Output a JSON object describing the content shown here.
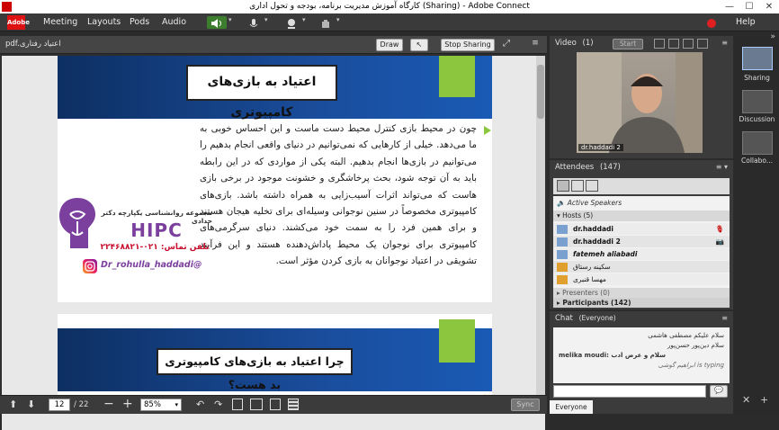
{
  "window": {
    "title": "کارگاه آموزش مدیریت برنامه، بودجه و تحول اداری (Sharing) - Adobe Connect",
    "help": "Help"
  },
  "menu": {
    "logo": "Adobe",
    "items": [
      "Meeting",
      "Layouts",
      "Pods",
      "Audio"
    ]
  },
  "share": {
    "filename": "pdf.اعتیاد رفتاری",
    "draw_label": "Draw",
    "stop_label": "Stop Sharing",
    "page_current": "12",
    "page_total": "/ 22",
    "zoom": "85%",
    "sync_label": "Sync"
  },
  "slide1": {
    "title": "اعتیاد به بازی‌های کامپیوتری",
    "body": "چون در محیط بازی کنترل محیط دست ماست و این احساس خوبی به ما می‌دهد. خیلی از کارهایی که نمی‌توانیم در دنیای واقعی انجام بدهیم را می‌توانیم در بازی‌ها انجام بدهیم. البته یکی از مواردی که در این رابطه باید به آن توجه شود، بحث پرخاشگری و خشونت موجود در برخی بازی هاست که می‌تواند اثرات آسیب‌زایی به همراه داشته باشد. بازی‌های کامپیوتری مخصوصاً در سنین نوجوانی وسیله‌ای برای تخلیه هیجان هستند و برای همین فرد را به سمت خود می‌کشند. دنیای سرگرمی‌های کامپیوتری برای نوجوان یک محیط پاداش‌دهنده هستند و این فرآیند تشویقی در اعتیاد نوجوانان به بازی کردن مؤثر است."
  },
  "watermark": {
    "org": "مجموعه روانشناسی یکپارچه دکتر حدادی",
    "brand": "HIPC",
    "phone_label": "تلفن تماس: ۰۲۱-۲۲۴۶۸۸۲۱",
    "instagram": "Dr_rohulla_haddadi@"
  },
  "slide2": {
    "title": "چرا اعتیاد به بازی‌های کامپیوتری بد هست؟"
  },
  "video": {
    "title": "Video",
    "count": "(1)",
    "start_label": "Start",
    "name_label": "dr.haddadi 2"
  },
  "attendees": {
    "title": "Attendees",
    "count": "(147)",
    "active_speakers": "Active Speakers",
    "hosts_header": "Hosts (5)",
    "hosts": [
      "dr.haddadi",
      "dr.haddadi 2",
      "fatemeh aliabadi",
      "سکینه رستاق",
      "مهسا قنبری"
    ],
    "presenters_header": "Presenters (0)",
    "participants_header": "Participants (142)"
  },
  "chat": {
    "title": "Chat",
    "scope": "(Everyone)",
    "messages": [
      "سلام علیکم مصطفی هاشمی",
      "سلام دین‌پور حسن‌پور",
      "melika moudi: سلام و عرض ادب",
      "is typing ابراهیم گوشی"
    ],
    "tab_label": "Everyone"
  },
  "layouts": {
    "items": [
      "Sharing",
      "Discussion",
      "Collabo..."
    ]
  },
  "colors": {
    "accent_green": "#8cc63f",
    "slide_blue": "#1a4d9c",
    "hipc_purple": "#7b3f9e"
  }
}
